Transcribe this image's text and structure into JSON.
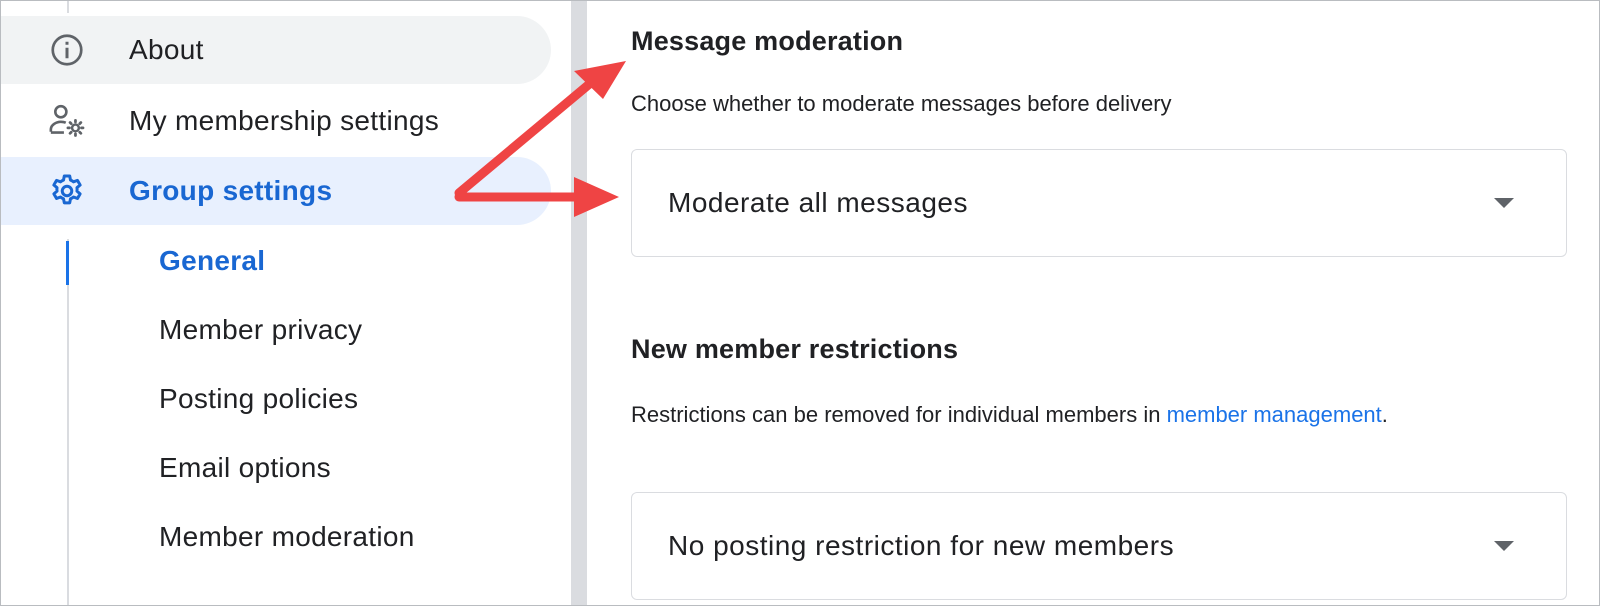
{
  "sidebar": {
    "items": [
      {
        "label": "About",
        "icon": "info-icon"
      },
      {
        "label": "My membership settings",
        "icon": "person-settings-icon"
      },
      {
        "label": "Group settings",
        "icon": "gear-icon"
      }
    ],
    "sub_items": [
      {
        "label": "General",
        "active": true
      },
      {
        "label": "Member privacy"
      },
      {
        "label": "Posting policies"
      },
      {
        "label": "Email options"
      },
      {
        "label": "Member moderation"
      }
    ]
  },
  "main": {
    "message_moderation": {
      "title": "Message moderation",
      "description": "Choose whether to moderate messages before delivery",
      "selected": "Moderate all messages"
    },
    "new_member_restrictions": {
      "title": "New member restrictions",
      "description_prefix": "Restrictions can be removed for individual members in ",
      "link_text": "member management",
      "description_suffix": ".",
      "selected": "No posting restriction for new members"
    }
  },
  "colors": {
    "accent": "#1967d2",
    "link": "#1a73e8",
    "annotation_arrow": "#ef4444",
    "active_bg": "#e8f0fe",
    "hover_bg": "#f1f3f4"
  }
}
